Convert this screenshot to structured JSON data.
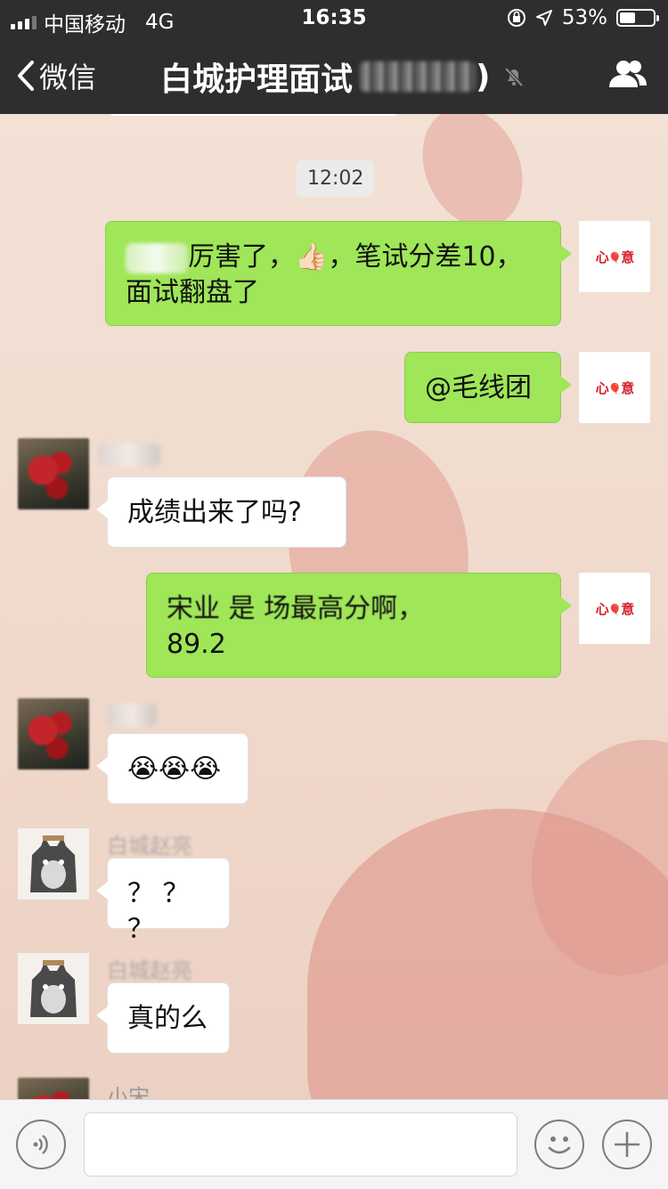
{
  "status": {
    "carrier": "中国移动",
    "network": "4G",
    "time": "16:35",
    "battery": "53%",
    "battery_level": 0.53
  },
  "nav": {
    "back_label": "微信",
    "title": "白城护理面试",
    "title_suffix": ")"
  },
  "chat": {
    "timestamp": "12:02",
    "messages": [
      {
        "side": "right",
        "text_visible": "厉害了，",
        "emoji": "👍🏻",
        "text_after": "，笔试分差10，",
        "line2": "面试翻盘了"
      },
      {
        "side": "right",
        "text": "@毛线团"
      },
      {
        "side": "left",
        "text": "成绩出来了吗?"
      },
      {
        "side": "right",
        "text_visible": "宋业  是  场最高分啊，",
        "line2": "89.2"
      },
      {
        "side": "left",
        "emoji": "😭😭😭"
      },
      {
        "side": "left",
        "sender": "白城赵亮",
        "text": "？ ？ ？"
      },
      {
        "side": "left",
        "sender": "白城赵亮",
        "text": "真的么"
      },
      {
        "side": "left",
        "sender": "小宋"
      }
    ]
  },
  "avatar_text": {
    "mine_a": "心",
    "mine_b": "意"
  },
  "input": {
    "placeholder": ""
  },
  "icons": {
    "back": "chevron-left-icon",
    "mute": "mute-bell-icon",
    "group": "group-members-icon",
    "voice": "voice-icon",
    "emoji": "emoji-icon",
    "plus": "plus-icon"
  },
  "colors": {
    "nav_bg": "#2e2e30",
    "bubble_self": "#9fe658",
    "bubble_other": "#ffffff"
  }
}
